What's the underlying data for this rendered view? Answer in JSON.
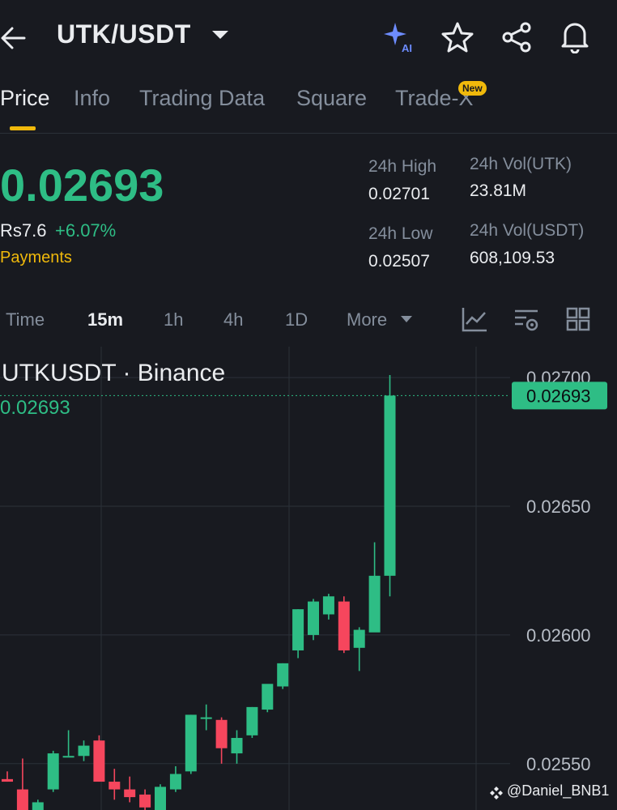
{
  "header": {
    "pair": "UTK/USDT",
    "icons": [
      "back-arrow-icon",
      "caret-down-icon",
      "ai-sparkle-icon",
      "star-icon",
      "share-icon",
      "bell-icon"
    ]
  },
  "tabs": [
    {
      "label": "Price",
      "active": true
    },
    {
      "label": "Info",
      "active": false
    },
    {
      "label": "Trading Data",
      "active": false
    },
    {
      "label": "Square",
      "active": false
    },
    {
      "label": "Trade-X",
      "active": false,
      "badge": "New"
    }
  ],
  "price": {
    "last": "0.02693",
    "fiat": "Rs7.6",
    "change": "+6.07%",
    "payments_label": "Payments"
  },
  "stats": {
    "high_label": "24h High",
    "high_value": "0.02701",
    "low_label": "24h Low",
    "low_value": "0.02507",
    "vol_base_label": "24h Vol(UTK)",
    "vol_base_value": "23.81M",
    "vol_quote_label": "24h Vol(USDT)",
    "vol_quote_value": "608,109.53"
  },
  "timeframes": {
    "items": [
      "Time",
      "15m",
      "1h",
      "4h",
      "1D",
      "More"
    ],
    "active": "15m"
  },
  "chart_header": {
    "symbol": "UTKUSDT · Binance",
    "last_value": "0.02693"
  },
  "colors": {
    "up": "#2ebd85",
    "down": "#f6465d",
    "accent": "#f0b90b",
    "bg": "#181a20"
  },
  "chart_data": {
    "type": "candlestick",
    "ylim": [
      0.02532,
      0.02712
    ],
    "y_ticks": [
      "0.02700",
      "0.02650",
      "0.02600",
      "0.02550"
    ],
    "last_price": 0.02693,
    "last_price_label": "0.02693",
    "candles": [
      {
        "o": 0.02544,
        "h": 0.02547,
        "l": 0.02543,
        "c": 0.02543
      },
      {
        "o": 0.0254,
        "h": 0.02552,
        "l": 0.02524,
        "c": 0.02524
      },
      {
        "o": 0.02525,
        "h": 0.02536,
        "l": 0.0252,
        "c": 0.02535
      },
      {
        "o": 0.0254,
        "h": 0.02555,
        "l": 0.02539,
        "c": 0.02554
      },
      {
        "o": 0.02553,
        "h": 0.02563,
        "l": 0.02553,
        "c": 0.02553
      },
      {
        "o": 0.02553,
        "h": 0.02559,
        "l": 0.02551,
        "c": 0.02557
      },
      {
        "o": 0.02559,
        "h": 0.02561,
        "l": 0.02543,
        "c": 0.02543
      },
      {
        "o": 0.02543,
        "h": 0.02548,
        "l": 0.02536,
        "c": 0.0254
      },
      {
        "o": 0.0254,
        "h": 0.02545,
        "l": 0.02535,
        "c": 0.02537
      },
      {
        "o": 0.02538,
        "h": 0.0254,
        "l": 0.02526,
        "c": 0.02533
      },
      {
        "o": 0.02532,
        "h": 0.02542,
        "l": 0.0253,
        "c": 0.02541
      },
      {
        "o": 0.0254,
        "h": 0.02549,
        "l": 0.02539,
        "c": 0.02546
      },
      {
        "o": 0.02547,
        "h": 0.02569,
        "l": 0.02546,
        "c": 0.02569
      },
      {
        "o": 0.02568,
        "h": 0.02573,
        "l": 0.02563,
        "c": 0.02568
      },
      {
        "o": 0.02567,
        "h": 0.02568,
        "l": 0.0255,
        "c": 0.02556
      },
      {
        "o": 0.02554,
        "h": 0.02563,
        "l": 0.0255,
        "c": 0.0256
      },
      {
        "o": 0.02561,
        "h": 0.02572,
        "l": 0.0256,
        "c": 0.02572
      },
      {
        "o": 0.02571,
        "h": 0.02576,
        "l": 0.0257,
        "c": 0.02581
      },
      {
        "o": 0.0258,
        "h": 0.02589,
        "l": 0.02579,
        "c": 0.02589
      },
      {
        "o": 0.02594,
        "h": 0.0261,
        "l": 0.02591,
        "c": 0.0261
      },
      {
        "o": 0.026,
        "h": 0.02614,
        "l": 0.02598,
        "c": 0.02613
      },
      {
        "o": 0.02608,
        "h": 0.02616,
        "l": 0.02606,
        "c": 0.02615
      },
      {
        "o": 0.02613,
        "h": 0.02615,
        "l": 0.02593,
        "c": 0.02594
      },
      {
        "o": 0.02595,
        "h": 0.02603,
        "l": 0.02586,
        "c": 0.02602
      },
      {
        "o": 0.02601,
        "h": 0.02636,
        "l": 0.02602,
        "c": 0.02623
      },
      {
        "o": 0.02623,
        "h": 0.02701,
        "l": 0.02615,
        "c": 0.02693
      }
    ]
  },
  "watermark": "@Daniel_BNB1"
}
